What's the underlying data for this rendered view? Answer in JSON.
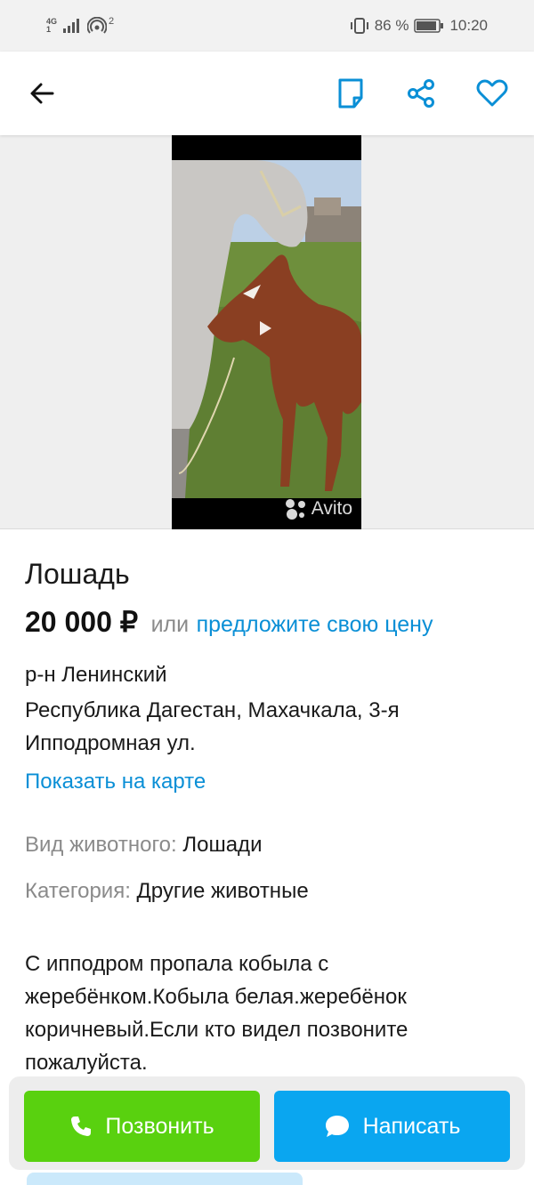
{
  "status_bar": {
    "network_top": "4G",
    "network_bottom": "1",
    "hotspot_sup": "2",
    "battery": "86 %",
    "time": "10:20"
  },
  "toolbar": {
    "back_icon": "arrow-left-icon",
    "note_icon": "note-icon",
    "share_icon": "share-icon",
    "favorite_icon": "heart-icon",
    "accent_color": "#0a8fd6"
  },
  "media": {
    "watermark": "Avito"
  },
  "listing": {
    "title": "Лошадь",
    "price": "20 000 ₽",
    "or_text": "или",
    "offer_link": "предложите свою цену",
    "address_line1": "р-н Ленинский",
    "address_line2": "Республика Дагестан, Махачкала, 3-я",
    "address_line3": "Ипподромная ул.",
    "map_link": "Показать на карте",
    "params": [
      {
        "label": "Вид животного:",
        "value": "Лошади"
      },
      {
        "label": "Категория:",
        "value": "Другие животные"
      }
    ],
    "description": "С ипподром пропала кобыла с жеребёнком.Кобыла белая.жеребёнок коричневый.Если кто видел позвоните пожалуйста."
  },
  "actions": {
    "call_label": "Позвонить",
    "write_label": "Написать",
    "call_color": "#59d10f",
    "write_color": "#0aa6f0"
  }
}
